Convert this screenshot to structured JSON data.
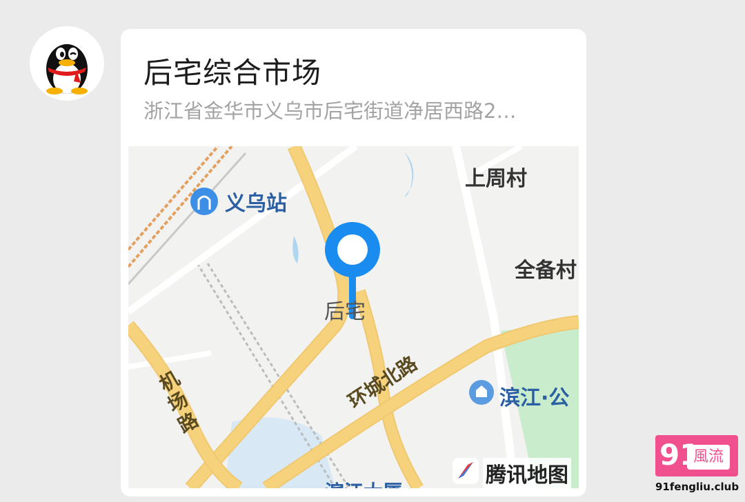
{
  "message": {
    "title": "后宅综合市场",
    "address": "浙江省金华市义乌市后宅街道净居西路2…"
  },
  "map": {
    "labels": {
      "yiwu_station": "义乌站",
      "shangzhou_village": "上周村",
      "quanbei_village": "全备村",
      "houzhai": "后宅",
      "jichang_road": [
        "机",
        "场",
        "路"
      ],
      "huancheng_north_road": "环城北路",
      "binjiang_park": "滨江·公",
      "bottom_partial": "滨江大厦"
    },
    "brand": "腾讯地图",
    "colors": {
      "pin": "#1a8cf0",
      "road": "#f6d27c",
      "park": "#c9eccc",
      "water": "#aed6f1"
    }
  },
  "watermark": {
    "number": "91",
    "text": "風流",
    "url": "91fengliu.club"
  }
}
